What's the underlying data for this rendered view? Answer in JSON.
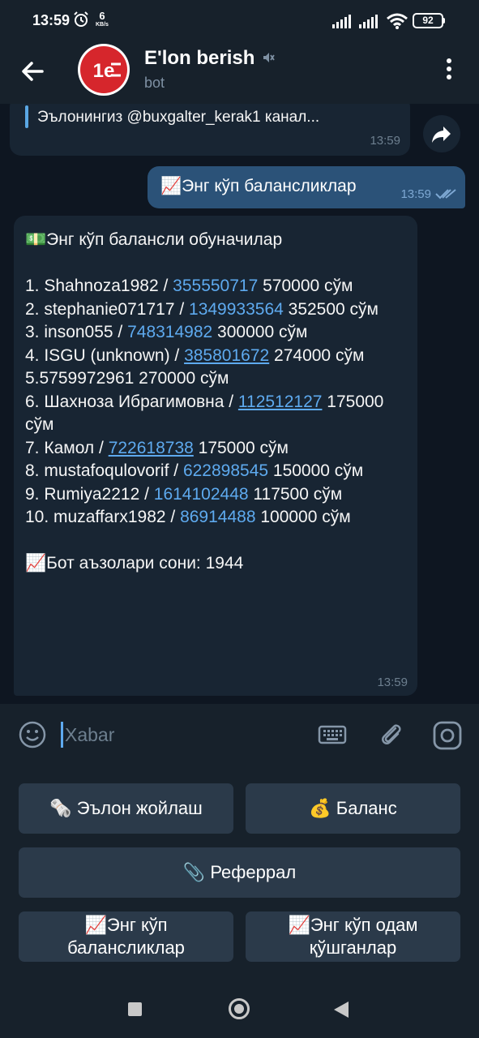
{
  "status_bar": {
    "time": "13:59",
    "net_speed_value": "6",
    "net_speed_unit": "KB/s",
    "battery": "92"
  },
  "header": {
    "title": "E'lon berish",
    "subtitle": "bot",
    "avatar_text": "1e"
  },
  "messages": {
    "forwarded": {
      "text": "Эълонингиз @buxgalter_kerak1 канал...",
      "time": "13:59"
    },
    "outgoing": {
      "text": "📈Энг кўп балансликлар",
      "time": "13:59"
    },
    "incoming": {
      "title": "💵Энг кўп балансли обуначилар",
      "rows": [
        {
          "prefix": "1. Shahnoza1982 / ",
          "id": "355550717",
          "underline": false,
          "suffix": "  570000 сўм"
        },
        {
          "prefix": "2. stephanie071717 / ",
          "id": "1349933564",
          "underline": false,
          "suffix": "  352500 сўм"
        },
        {
          "prefix": "3. inson055 / ",
          "id": "748314982",
          "underline": false,
          "suffix": "  300000 сўм"
        },
        {
          "prefix": "4. ISGU (unknown) / ",
          "id": "385801672",
          "underline": true,
          "suffix": " 274000 сўм"
        },
        {
          "prefix": "5.5759972961 270000 сўм",
          "id": "",
          "underline": false,
          "suffix": ""
        },
        {
          "prefix": "6. Шахноза Ибрагимовна / ",
          "id": "112512127",
          "underline": true,
          "suffix": " 175000 сўм"
        },
        {
          "prefix": "7. Камол / ",
          "id": "722618738",
          "underline": true,
          "suffix": " 175000 сўм"
        },
        {
          "prefix": "8. mustafoqulovorif / ",
          "id": "622898545",
          "underline": false,
          "suffix": "  150000 сўм"
        },
        {
          "prefix": "9. Rumiya2212 / ",
          "id": "1614102448",
          "underline": false,
          "suffix": "  117500 сўм"
        },
        {
          "prefix": "10. muzaffarx1982 / ",
          "id": "86914488",
          "underline": false,
          "suffix": "  100000 сўм"
        }
      ],
      "footer": "📈Бот аъзолари сони: 1944",
      "time": "13:59"
    }
  },
  "composer": {
    "placeholder": "Xabar"
  },
  "keyboard": {
    "post_ad": "🗞️ Эълон жойлаш",
    "balance": "💰 Баланс",
    "referral": "📎 Реферрал",
    "top_balances": "📈Энг кўп балансликлар",
    "top_inviters": "📈Энг кўп одам қўшганлар"
  },
  "colors": {
    "bg": "#0e1621",
    "bar": "#17212b",
    "bubble_in": "#182533",
    "bubble_out": "#2b5278",
    "link": "#5eaaef",
    "key": "#2b3a4a"
  }
}
